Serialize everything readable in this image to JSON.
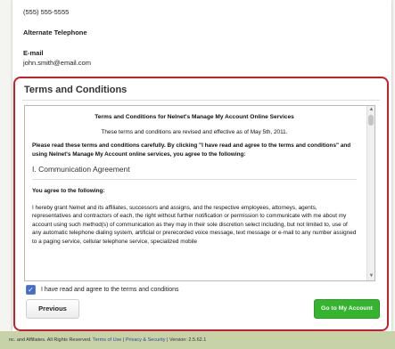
{
  "contact": {
    "phone": "(555) 555-5555",
    "alt_phone_label": "Alternate Telephone",
    "email_label": "E-mail",
    "email_value": "john.smith@email.com"
  },
  "terms": {
    "panel_title": "Terms and Conditions",
    "doc_heading": "Terms and Conditions for Nelnet's Manage My Account Online Services",
    "effective": "These terms and conditions are revised and effective as of May 5th, 2011.",
    "intro": "Please read these terms and conditions carefully. By clicking \"I have read and agree to the terms and conditions\" and using Nelnet's Manage My Account online services, you agree to the following:",
    "section_title": "I. Communication Agreement",
    "agree_heading": "You agree to the following:",
    "body": "I hereby grant Nelnet and its affiliates, successors and assigns, and the respective employees, attorneys, agents, representatives and contractors of each, the right without further notification or permission to communicate with me about my account using such method(s) of communication as they may in their sole discretion select including, but not limited to, use of any automatic telephone dialing system, artificial or prerecorded voice message, text message or e-mail to any number assigned to a paging service, cellular telephone service, specialized mobile"
  },
  "agree_checkbox_label": "I have read and agree to the terms and conditions",
  "buttons": {
    "previous": "Previous",
    "next": "Go to My Account"
  },
  "footer": {
    "prefix": "nc. and Affiliates. All Rights Reserved.",
    "terms_link": "Terms of Use",
    "sep": "|",
    "privacy_link": "Privacy & Security",
    "version": "| Version: 2.5.62.1"
  },
  "colors": {
    "panel_border": "#c8202a",
    "primary_button": "#35b52f",
    "footer_bg": "#c8d2a8"
  }
}
